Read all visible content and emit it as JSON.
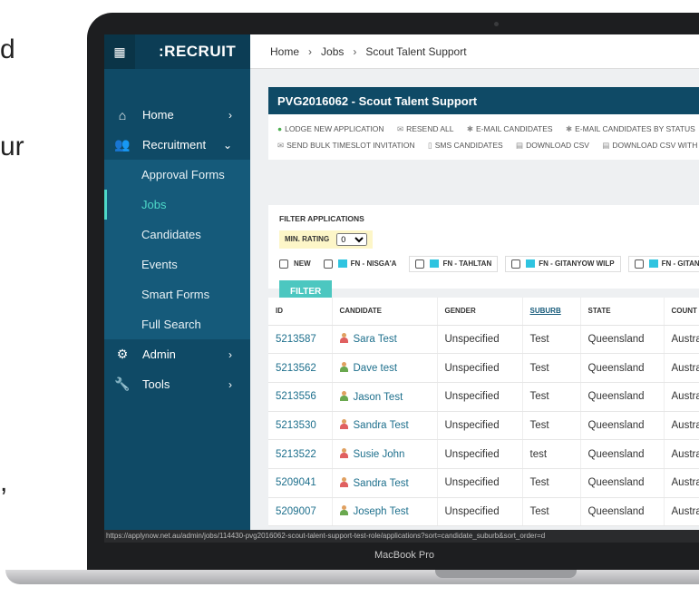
{
  "left_fragments": [
    "d",
    "ur",
    ","
  ],
  "app": {
    "title": ":RECRUIT",
    "device_label": "MacBook Pro"
  },
  "sidebar": {
    "items": [
      {
        "label": "Home",
        "icon": "home-icon",
        "glyph": "⌂",
        "chevron": "›"
      },
      {
        "label": "Recruitment",
        "icon": "users-icon",
        "glyph": "👥",
        "chevron": "⌄"
      },
      {
        "label": "Admin",
        "icon": "gear-icon",
        "glyph": "⚙",
        "chevron": "›"
      },
      {
        "label": "Tools",
        "icon": "wrench-icon",
        "glyph": "🔧",
        "chevron": "›"
      }
    ],
    "sub_items": [
      "Approval Forms",
      "Jobs",
      "Candidates",
      "Events",
      "Smart Forms",
      "Full Search"
    ],
    "active_sub": "Jobs"
  },
  "breadcrumb": [
    "Home",
    "Jobs",
    "Scout Talent Support"
  ],
  "job": {
    "title": "PVG2016062 - Scout Talent Support",
    "actions_row1": [
      "LODGE NEW APPLICATION",
      "RESEND ALL",
      "E-MAIL CANDIDATES",
      "E-MAIL CANDIDATES BY STATUS"
    ],
    "actions_row2": [
      "SEND BULK TIMESLOT INVITATION",
      "SMS CANDIDATES",
      "DOWNLOAD CSV",
      "DOWNLOAD CSV WITH AI"
    ]
  },
  "filter": {
    "title": "FILTER APPLICATIONS",
    "min_rating_label": "MIN. RATING",
    "min_rating_value": "0",
    "checkboxes": [
      "NEW",
      "FN - NISGA'A",
      "FN - TAHLTAN",
      "FN - GITANYOW WILP",
      "FN - GITAN"
    ],
    "button": "FILTER"
  },
  "table": {
    "headers": [
      "ID",
      "CANDIDATE",
      "GENDER",
      "SUBURB",
      "STATE",
      "COUNT"
    ],
    "rows": [
      {
        "id": "5213587",
        "candidate": "Sara Test",
        "gender": "Unspecified",
        "suburb": "Test",
        "state": "Queensland",
        "country": "Austra",
        "avatar": "f"
      },
      {
        "id": "5213562",
        "candidate": "Dave test",
        "gender": "Unspecified",
        "suburb": "Test",
        "state": "Queensland",
        "country": "Austra",
        "avatar": "m"
      },
      {
        "id": "5213556",
        "candidate": "Jason Test",
        "gender": "Unspecified",
        "suburb": "Test",
        "state": "Queensland",
        "country": "Austra",
        "avatar": "m"
      },
      {
        "id": "5213530",
        "candidate": "Sandra Test",
        "gender": "Unspecified",
        "suburb": "Test",
        "state": "Queensland",
        "country": "Austra",
        "avatar": "f"
      },
      {
        "id": "5213522",
        "candidate": "Susie John",
        "gender": "Unspecified",
        "suburb": "test",
        "state": "Queensland",
        "country": "Austra",
        "avatar": "f"
      },
      {
        "id": "5209041",
        "candidate": "Sandra Test",
        "gender": "Unspecified",
        "suburb": "Test",
        "state": "Queensland",
        "country": "Austra",
        "avatar": "f"
      },
      {
        "id": "5209007",
        "candidate": "Joseph Test",
        "gender": "Unspecified",
        "suburb": "Test",
        "state": "Queensland",
        "country": "Austra",
        "avatar": "m"
      }
    ]
  },
  "status_url": "https://applynow.net.au/admin/jobs/114430-pvg2016062-scout-talent-support-test-role/applications?sort=candidate_suburb&sort_order=d"
}
